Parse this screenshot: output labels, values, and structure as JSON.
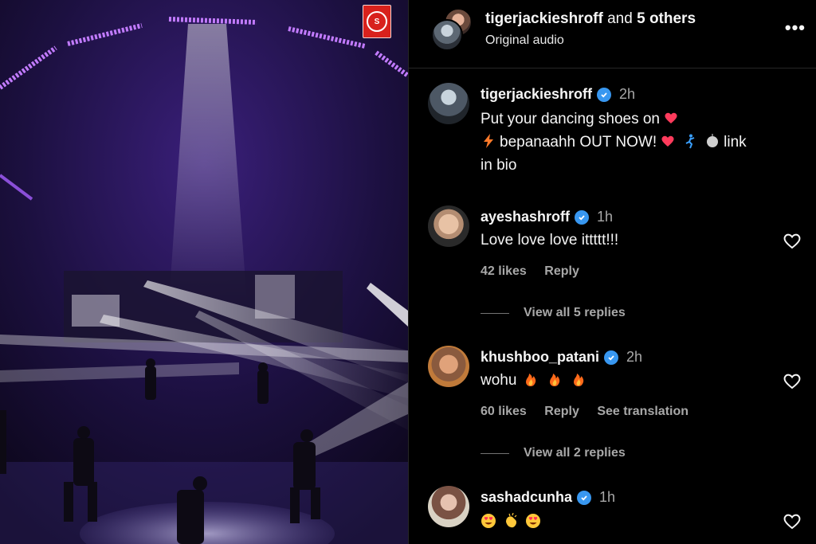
{
  "media": {
    "watermark": "S"
  },
  "header": {
    "username": "tigerjackieshroff",
    "and_text": "and",
    "others": "5 others",
    "audio": "Original audio",
    "more_icon": "more-horizontal-icon"
  },
  "caption": {
    "username": "tigerjackieshroff",
    "time": "2h",
    "line1": "Put your dancing shoes on",
    "line2": "bepanaahh OUT NOW!",
    "line2_end": "link",
    "line3": "in bio"
  },
  "comments": [
    {
      "username": "ayeshashroff",
      "time": "1h",
      "text": "Love love love ittttt!!!",
      "likes": "42 likes",
      "reply": "Reply",
      "view_replies": "View all 5 replies"
    },
    {
      "username": "khushboo_patani",
      "time": "2h",
      "text": "wohu",
      "likes": "60 likes",
      "reply": "Reply",
      "translate": "See translation",
      "view_replies": "View all 2 replies"
    },
    {
      "username": "sashadcunha",
      "time": "1h",
      "text": ""
    }
  ],
  "colors": {
    "verified": "#3897f0",
    "heart": "#ff3b5c",
    "muted": "#a8a8a8"
  }
}
